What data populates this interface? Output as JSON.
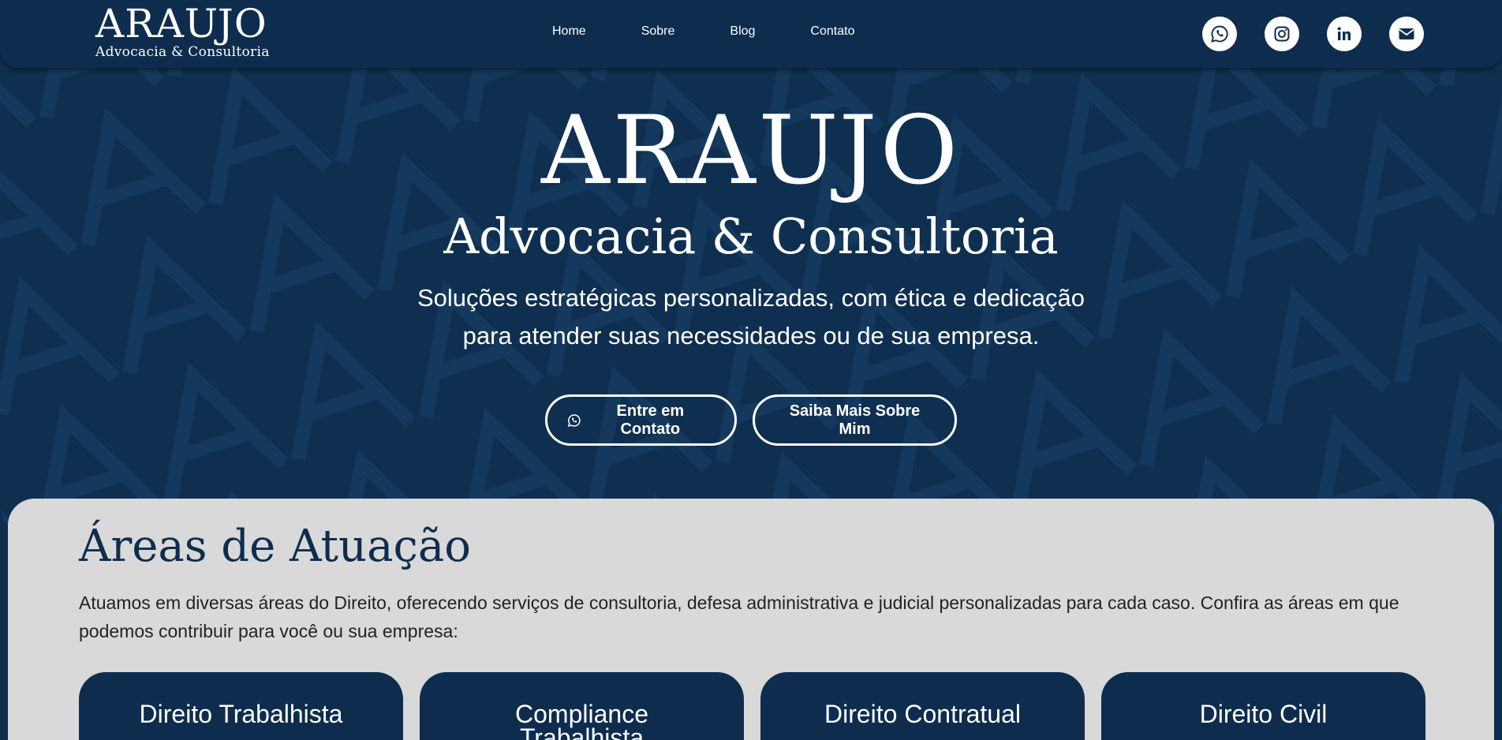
{
  "header": {
    "logo_main": "ARAUJO",
    "logo_sub": "Advocacia & Consultoria",
    "nav": [
      "Home",
      "Sobre",
      "Blog",
      "Contato"
    ],
    "socials": [
      "whatsapp-icon",
      "instagram-icon",
      "linkedin-icon",
      "email-icon"
    ]
  },
  "hero": {
    "title": "ARAUJO",
    "subtitle": "Advocacia & Consultoria",
    "text": "Soluções estratégicas personalizadas, com ética e dedicação para atender suas necessidades ou de sua empresa.",
    "button_contact": "Entre em Contato",
    "button_about": "Saiba Mais Sobre Mim"
  },
  "areas": {
    "title": "Áreas de Atuação",
    "intro": "Atuamos em diversas áreas do Direito, oferecendo serviços de consultoria, defesa administrativa e judicial personalizadas para cada caso. Confira as áreas em que podemos contribuir para você ou sua empresa:",
    "cards": [
      "Direito Trabalhista",
      "Compliance Trabalhista",
      "Direito Contratual",
      "Direito Civil"
    ]
  },
  "colors": {
    "navy": "#0e2d4e",
    "section_bg": "#d9d9d9",
    "white": "#ffffff"
  }
}
